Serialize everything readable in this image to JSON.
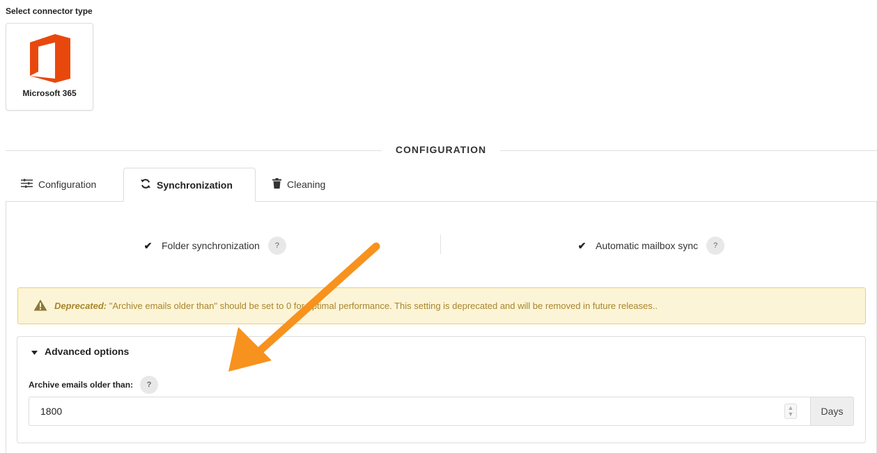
{
  "connector": {
    "section_label": "Select connector type",
    "name": "Microsoft 365",
    "logo_color": "#e9480c"
  },
  "divider": {
    "title": "CONFIGURATION"
  },
  "tabs": [
    {
      "label": "Configuration",
      "icon": "sliders-icon",
      "active": false
    },
    {
      "label": "Synchronization",
      "icon": "sync-icon",
      "active": true
    },
    {
      "label": "Cleaning",
      "icon": "trash-icon",
      "active": false
    }
  ],
  "sync": {
    "folder_sync": {
      "label": "Folder synchronization",
      "checked": true,
      "help": "?"
    },
    "mailbox_sync": {
      "label": "Automatic mailbox sync",
      "checked": true,
      "help": "?"
    }
  },
  "warning": {
    "prefix": "Deprecated:",
    "message": "\"Archive emails older than\" should be set to 0 for optimal performance. This setting is deprecated and will be removed in future releases..",
    "icon": "warning-icon",
    "colors": {
      "background": "#fcf4d6",
      "border": "#e7cf7f",
      "text": "#a7862b"
    }
  },
  "advanced": {
    "title": "Advanced options",
    "archive_label": "Archive emails older than:",
    "archive_help": "?",
    "archive_value": "1800",
    "unit": "Days"
  },
  "annotation": {
    "arrow_color": "#f7921e"
  }
}
